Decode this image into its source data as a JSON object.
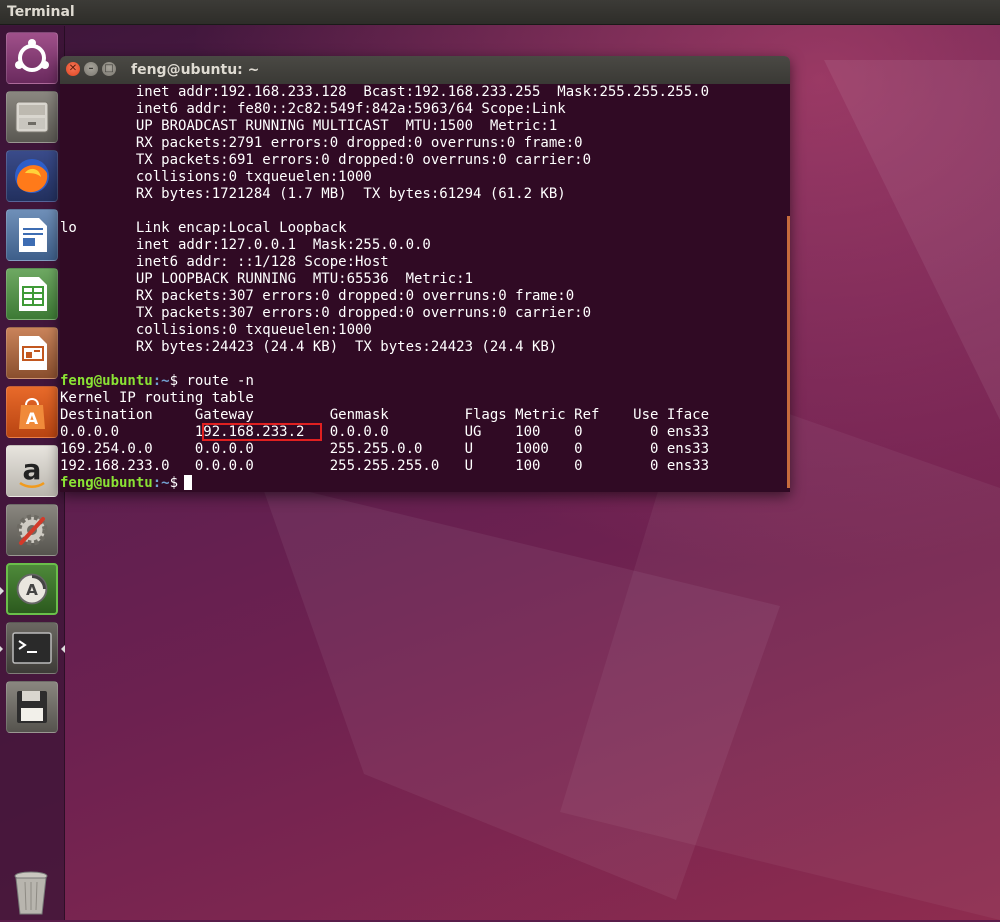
{
  "topbar": {
    "title": "Terminal"
  },
  "launcher": {
    "items": [
      {
        "name": "ubuntu-dash-icon"
      },
      {
        "name": "file-cabinet-icon"
      },
      {
        "name": "firefox-icon"
      },
      {
        "name": "libreoffice-writer-icon"
      },
      {
        "name": "libreoffice-calc-icon"
      },
      {
        "name": "libreoffice-impress-icon"
      },
      {
        "name": "ubuntu-software-icon"
      },
      {
        "name": "amazon-icon"
      },
      {
        "name": "system-settings-icon"
      },
      {
        "name": "software-updater-icon"
      },
      {
        "name": "terminal-icon"
      },
      {
        "name": "save-disk-icon"
      },
      {
        "name": "trash-icon"
      }
    ]
  },
  "terminal": {
    "title": "feng@ubuntu: ~",
    "lines": {
      "l1": "         inet addr:192.168.233.128  Bcast:192.168.233.255  Mask:255.255.255.0",
      "l2": "         inet6 addr: fe80::2c82:549f:842a:5963/64 Scope:Link",
      "l3": "         UP BROADCAST RUNNING MULTICAST  MTU:1500  Metric:1",
      "l4": "         RX packets:2791 errors:0 dropped:0 overruns:0 frame:0",
      "l5": "         TX packets:691 errors:0 dropped:0 overruns:0 carrier:0",
      "l6": "         collisions:0 txqueuelen:1000",
      "l7": "         RX bytes:1721284 (1.7 MB)  TX bytes:61294 (61.2 KB)",
      "l8": "",
      "l9": "lo       Link encap:Local Loopback",
      "l10": "         inet addr:127.0.0.1  Mask:255.0.0.0",
      "l11": "         inet6 addr: ::1/128 Scope:Host",
      "l12": "         UP LOOPBACK RUNNING  MTU:65536  Metric:1",
      "l13": "         RX packets:307 errors:0 dropped:0 overruns:0 frame:0",
      "l14": "         TX packets:307 errors:0 dropped:0 overruns:0 carrier:0",
      "l15": "         collisions:0 txqueuelen:1000",
      "l16": "         RX bytes:24423 (24.4 KB)  TX bytes:24423 (24.4 KB)",
      "l17": "",
      "prompt_user": "feng@ubuntu",
      "prompt_path": ":~",
      "prompt_sign": "$",
      "command": " route -n",
      "l19": "Kernel IP routing table",
      "l20": "Destination     Gateway         Genmask         Flags Metric Ref    Use Iface",
      "l21": "0.0.0.0         192.168.233.2   0.0.0.0         UG    100    0        0 ens33",
      "l22": "169.254.0.0     0.0.0.0         255.255.0.0     U     1000   0        0 ens33",
      "l23": "192.168.233.0   0.0.0.0         255.255.255.0   U     100    0        0 ens33"
    }
  },
  "colors": {
    "terminal_bg": "#300a24",
    "prompt": "#8ae234",
    "highlight_box": "#e02020"
  }
}
